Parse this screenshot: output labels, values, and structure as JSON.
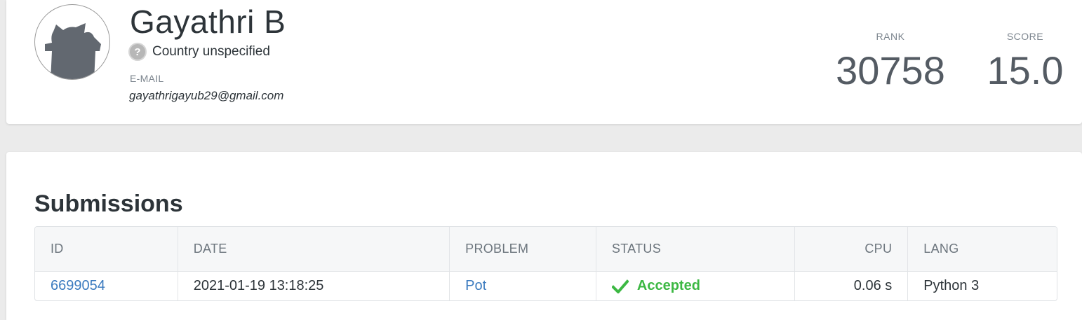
{
  "profile": {
    "name": "Gayathri B",
    "country": "Country unspecified",
    "email_label": "E-MAIL",
    "email": "gayathrigayub29@gmail.com"
  },
  "stats": {
    "rank_label": "RANK",
    "rank_value": "30758",
    "score_label": "SCORE",
    "score_value": "15.0"
  },
  "submissions": {
    "title": "Submissions",
    "columns": [
      "ID",
      "DATE",
      "PROBLEM",
      "STATUS",
      "CPU",
      "LANG"
    ],
    "rows": [
      {
        "id": "6699054",
        "date": "2021-01-19 13:18:25",
        "problem": "Pot",
        "status": "Accepted",
        "cpu": "0.06 s",
        "lang": "Python 3"
      }
    ]
  },
  "icons": {
    "avatar": "default-avatar-icon",
    "country": "question-mark-icon",
    "status": "checkmark-icon"
  },
  "colors": {
    "accepted": "#3cb843",
    "link": "#3b7bbf",
    "page_background": "#ebebeb"
  }
}
